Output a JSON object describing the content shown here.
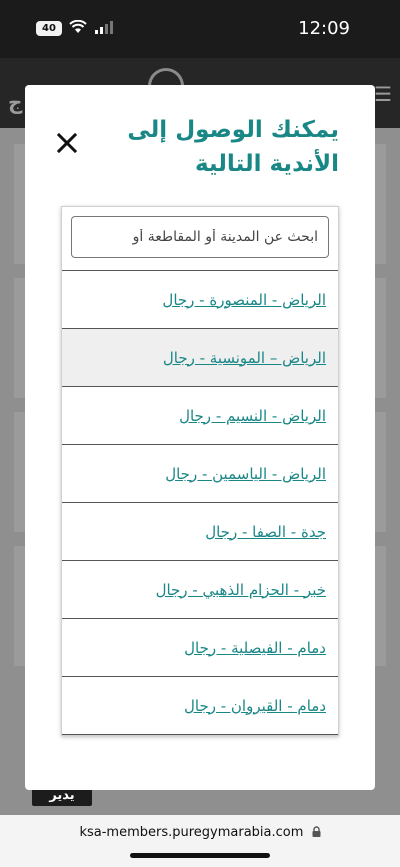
{
  "status": {
    "battery": "40",
    "time": "12:09"
  },
  "modal": {
    "title_line1": "يمكنك الوصول إلى",
    "title_line2": "الأندية التالية",
    "search_placeholder": "ابحث عن المدينة أو المقاطعة أو",
    "clubs": [
      {
        "label": "الرياض - المنصورة - رجال"
      },
      {
        "label": "الرياض – المونسية - رجال"
      },
      {
        "label": "الرياض - النسيم - رجال"
      },
      {
        "label": "الرياض - الياسمين - رجال"
      },
      {
        "label": "جدة - الصفا - رجال"
      },
      {
        "label": "خبر - الحزام الذهبي - رجال"
      },
      {
        "label": "دمام - الفيصلية - رجال"
      },
      {
        "label": "دمام - القيروان - رجال"
      }
    ]
  },
  "background": {
    "button_label": "يدير"
  },
  "browser": {
    "url": "ksa-members.puregymarabia.com"
  },
  "icons": {
    "close": "close-icon",
    "wifi": "wifi-icon",
    "signal": "signal-icon",
    "lock": "lock-icon",
    "menu": "menu-icon"
  },
  "colors": {
    "accent": "#1a8787"
  }
}
